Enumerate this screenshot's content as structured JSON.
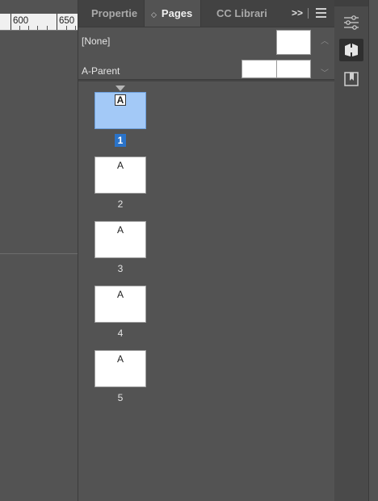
{
  "ruler": {
    "labels": [
      "600",
      "650"
    ]
  },
  "panel": {
    "tabs": [
      {
        "label": "Propertie",
        "active": false
      },
      {
        "label": "Pages",
        "active": true
      },
      {
        "label": "CC Librari",
        "active": false
      }
    ],
    "overflow_label": ">>",
    "parents": [
      {
        "label": "[None]"
      },
      {
        "label": "A-Parent"
      }
    ],
    "pages": [
      {
        "prefix": "A",
        "number": "1",
        "selected": true
      },
      {
        "prefix": "A",
        "number": "2",
        "selected": false
      },
      {
        "prefix": "A",
        "number": "3",
        "selected": false
      },
      {
        "prefix": "A",
        "number": "4",
        "selected": false
      },
      {
        "prefix": "A",
        "number": "5",
        "selected": false
      }
    ]
  },
  "icon_strip": [
    {
      "icon": "properties-sliders-icon",
      "active": false
    },
    {
      "icon": "pages-icon",
      "active": true
    },
    {
      "icon": "cc-libraries-icon",
      "active": false
    }
  ],
  "colors": {
    "panel_bg": "#535353",
    "tabbar_bg": "#424242",
    "selected_page": "#a3c9f7",
    "selected_number": "#2a73c9"
  }
}
